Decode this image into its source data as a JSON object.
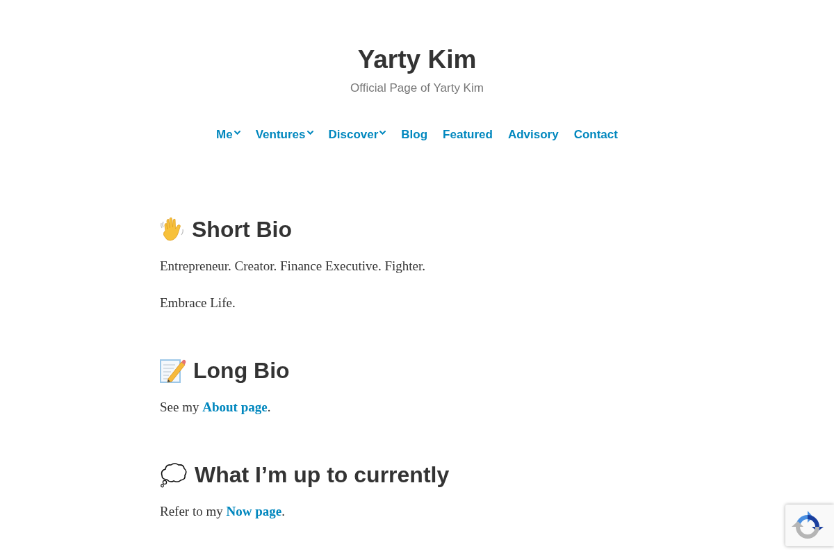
{
  "site": {
    "title": "Yarty Kim",
    "tagline": "Official Page of Yarty Kim"
  },
  "nav": [
    {
      "label": "Me",
      "submenu": true
    },
    {
      "label": "Ventures",
      "submenu": true
    },
    {
      "label": "Discover",
      "submenu": true
    },
    {
      "label": "Blog",
      "submenu": false
    },
    {
      "label": "Featured",
      "submenu": false
    },
    {
      "label": "Advisory",
      "submenu": false
    },
    {
      "label": "Contact",
      "submenu": false
    }
  ],
  "sections": [
    {
      "heading": "Short Bio",
      "paragraphs": [
        {
          "text": "Entrepreneur. Creator. Finance Executive. Fighter."
        },
        {
          "text": "Embrace Life."
        }
      ]
    },
    {
      "heading": "Long Bio",
      "paragraphs": [
        {
          "text": "See my ",
          "link": "About page",
          "after": "."
        }
      ]
    },
    {
      "heading": "What I’m up to currently",
      "paragraphs": [
        {
          "text": "Refer to my ",
          "link": "Now page",
          "after": "."
        }
      ]
    }
  ]
}
